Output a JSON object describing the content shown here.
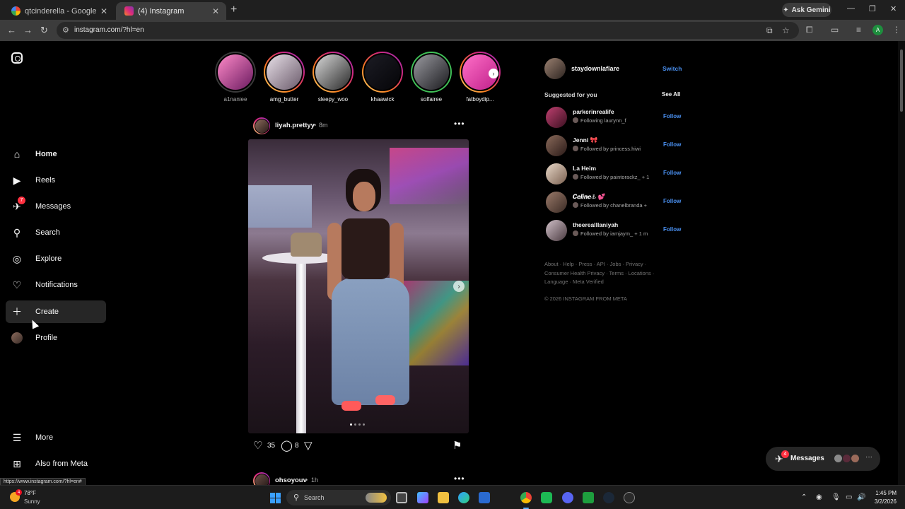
{
  "browser": {
    "tabs": [
      {
        "title": "qtcinderella - Google Search",
        "active": false
      },
      {
        "title": "(4) Instagram",
        "active": true
      }
    ],
    "gemini_label": "Ask Gemini",
    "url": "instagram.com/?hl=en",
    "profile_initial": "A"
  },
  "sidebar": {
    "items": [
      {
        "label": "Home",
        "icon": "home-icon"
      },
      {
        "label": "Reels",
        "icon": "reels-icon"
      },
      {
        "label": "Messages",
        "icon": "messages-icon",
        "badge": "7"
      },
      {
        "label": "Search",
        "icon": "search-icon"
      },
      {
        "label": "Explore",
        "icon": "explore-icon"
      },
      {
        "label": "Notifications",
        "icon": "heart-icon"
      },
      {
        "label": "Create",
        "icon": "plus-icon"
      },
      {
        "label": "Profile",
        "icon": "avatar"
      }
    ],
    "bottom": [
      {
        "label": "More",
        "icon": "menu-icon"
      },
      {
        "label": "Also from Meta",
        "icon": "meta-apps-icon"
      }
    ]
  },
  "stories": [
    {
      "name": "a1naniee",
      "seen": true
    },
    {
      "name": "amg_butter",
      "seen": false
    },
    {
      "name": "sleepy_woo",
      "seen": false
    },
    {
      "name": "khaawick",
      "seen": false
    },
    {
      "name": "solfairee",
      "seen": false,
      "close_friends": true
    },
    {
      "name": "fatboydip...",
      "seen": false
    }
  ],
  "post": {
    "username": "liyah.prettyy",
    "time": "8m",
    "likes": "35",
    "comments": "8",
    "carousel_count": 4,
    "carousel_index": 1
  },
  "post2": {
    "username": "ohsoyouv",
    "time": "1h"
  },
  "right": {
    "me": "staydownlaflare",
    "switch_label": "Switch",
    "suggested_title": "Suggested for you",
    "see_all": "See All",
    "follow_label": "Follow",
    "suggestions": [
      {
        "name": "parkerinrealife",
        "sub": "Following laurynn_f"
      },
      {
        "name": "Jenni 🎀",
        "sub": "Followed by princess.hiwi"
      },
      {
        "name": "La Heim",
        "sub": "Followed by paintorackz_ + 1"
      },
      {
        "name": "𝑪𝒆𝒍𝒊𝒏𝒆⚓ 💕",
        "sub": "Followed by chanelbranda +"
      },
      {
        "name": "theerealllaniyah",
        "sub": "Followed by iamjaym_ + 1 m"
      }
    ],
    "footer": "About · Help · Press · API · Jobs · Privacy · Consumer Health Privacy · Terms · Locations · Language · Meta Verified",
    "copyright": "© 2026 INSTAGRAM FROM META"
  },
  "messages_pill": {
    "label": "Messages",
    "badge": "4"
  },
  "status_url": "https://www.instagram.com/?hl=en#",
  "taskbar": {
    "weather_badge": "4",
    "temperature": "78°F",
    "condition": "Sunny",
    "search_placeholder": "Search",
    "time": "1:45 PM",
    "date": "3/2/2026"
  }
}
